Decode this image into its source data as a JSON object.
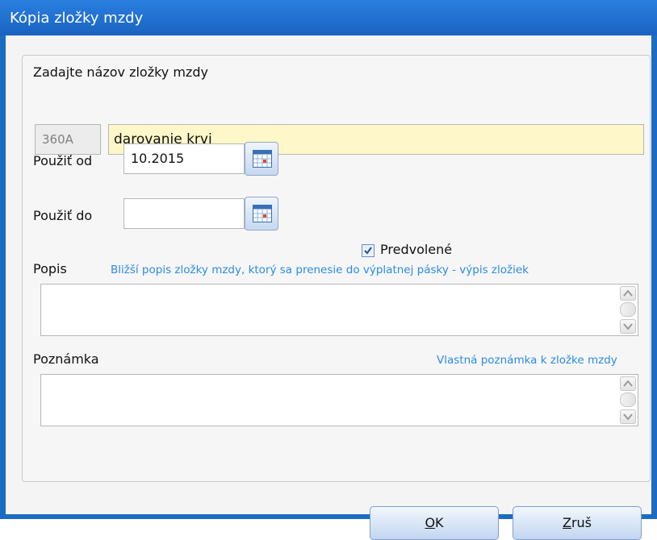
{
  "window": {
    "title": "Kópia zložky mzdy"
  },
  "form": {
    "name_label": "Zadajte názov zložky mzdy",
    "code_value": "360A",
    "name_value": "darovanie krvi",
    "from_label": "Použiť od",
    "from_value": "10.2015",
    "to_label": "Použiť do",
    "to_value": "",
    "default_label": "Predvolené",
    "default_checked": true,
    "popis_label": "Popis",
    "popis_hint": "Bližší popis zložky mzdy, ktorý sa prenesie do výplatnej pásky - výpis zložiek",
    "popis_value": "",
    "poznamka_label": "Poznámka",
    "poznamka_hint": "Vlastná poznámka k zložke mzdy",
    "poznamka_value": ""
  },
  "buttons": {
    "ok_mnemonic": "O",
    "ok_rest": "K",
    "cancel_mnemonic": "Z",
    "cancel_rest": "ruš"
  },
  "icons": {
    "calendar": "calendar-icon",
    "check": "check-icon",
    "scroll_up": "scroll-up-arrow-icon",
    "scroll_down": "scroll-down-arrow-icon"
  },
  "colors": {
    "title_bar": "#1a63c0",
    "hint_text": "#2b8ce6",
    "name_field_bg": "#fdf7c9"
  }
}
